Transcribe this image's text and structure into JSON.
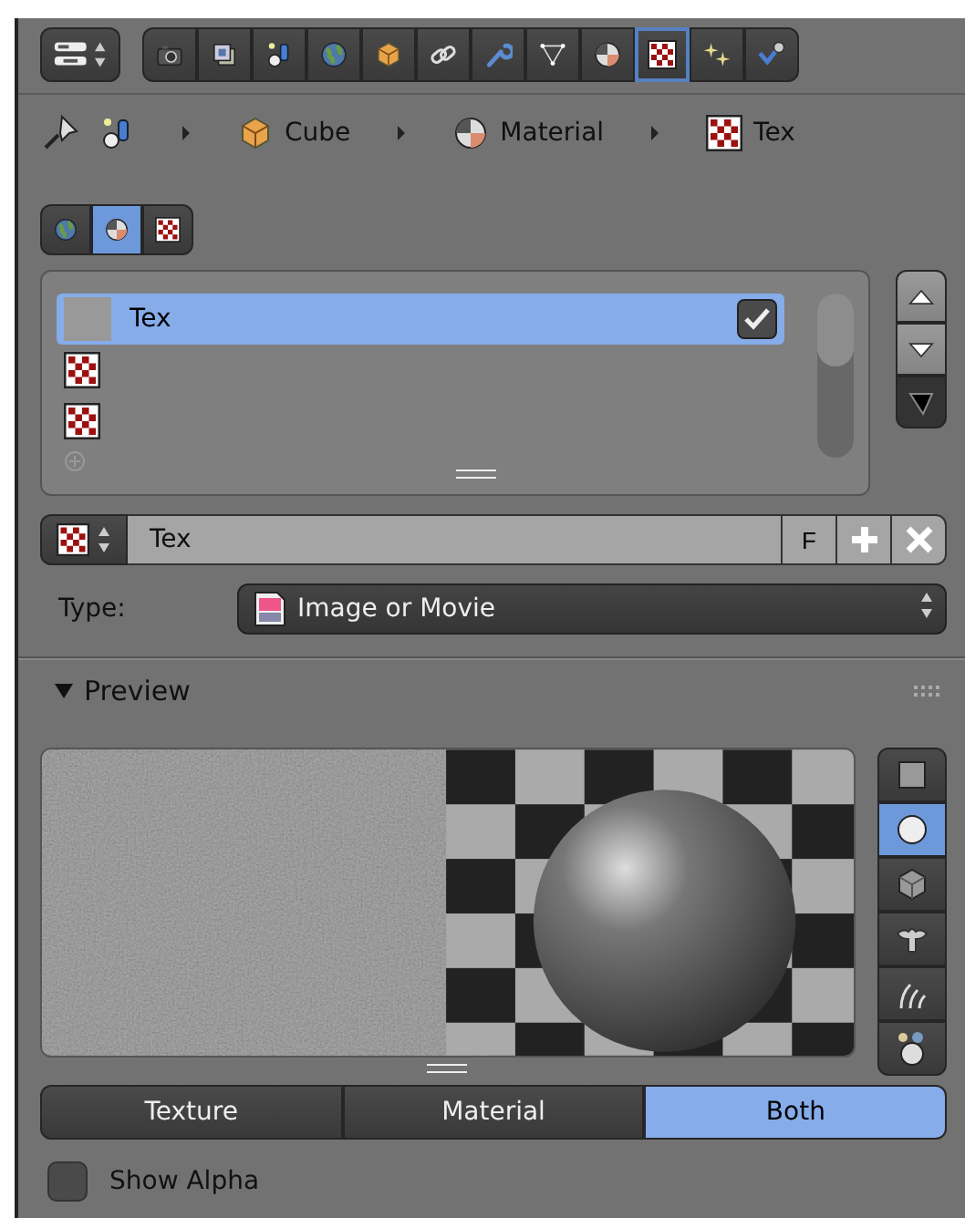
{
  "header": {
    "editor_button": {
      "kind": "properties"
    },
    "tabs": [
      {
        "kind": "render",
        "selected": false
      },
      {
        "kind": "layers",
        "selected": false
      },
      {
        "kind": "scene",
        "selected": false
      },
      {
        "kind": "world",
        "selected": false
      },
      {
        "kind": "object",
        "selected": false
      },
      {
        "kind": "constraints",
        "selected": false
      },
      {
        "kind": "modifiers",
        "selected": false
      },
      {
        "kind": "data",
        "selected": false
      },
      {
        "kind": "material",
        "selected": false
      },
      {
        "kind": "texture",
        "selected": true
      },
      {
        "kind": "particles",
        "selected": false
      },
      {
        "kind": "physics",
        "selected": false
      }
    ]
  },
  "breadcrumb": [
    {
      "kind": "object",
      "label": "Cube"
    },
    {
      "kind": "material",
      "label": "Material"
    },
    {
      "kind": "texture",
      "label": "Tex"
    }
  ],
  "context_tabs": [
    {
      "kind": "world",
      "selected": false
    },
    {
      "kind": "material",
      "selected": true
    },
    {
      "kind": "brush",
      "selected": false
    }
  ],
  "texture_slots": [
    {
      "kind": "image",
      "name": "Tex",
      "selected": true,
      "checked": true
    },
    {
      "kind": "checker",
      "selected": false
    },
    {
      "kind": "checker",
      "selected": false
    }
  ],
  "texture_id": {
    "name": "Tex",
    "fake_user_label": "F"
  },
  "type": {
    "label": "Type:",
    "value": "Image or Movie"
  },
  "preview": {
    "title": "Preview",
    "expanded": true,
    "shapes": [
      {
        "kind": "flat",
        "selected": false
      },
      {
        "kind": "sphere",
        "selected": true
      },
      {
        "kind": "cube",
        "selected": false
      },
      {
        "kind": "monkey",
        "selected": false
      },
      {
        "kind": "hair",
        "selected": false
      },
      {
        "kind": "sky",
        "selected": false
      }
    ],
    "modes": [
      {
        "label": "Texture",
        "selected": false
      },
      {
        "label": "Material",
        "selected": false
      },
      {
        "label": "Both",
        "selected": true
      }
    ],
    "show_alpha": {
      "label": "Show Alpha",
      "checked": false
    }
  }
}
